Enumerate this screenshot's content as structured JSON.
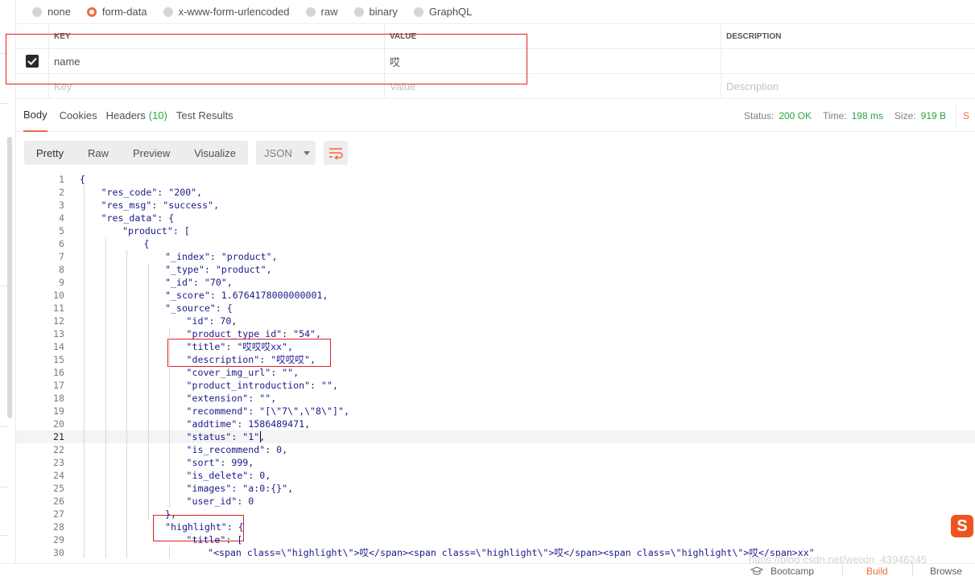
{
  "body_types": [
    {
      "label": "none",
      "selected": false
    },
    {
      "label": "form-data",
      "selected": true
    },
    {
      "label": "x-www-form-urlencoded",
      "selected": false
    },
    {
      "label": "raw",
      "selected": false
    },
    {
      "label": "binary",
      "selected": false
    },
    {
      "label": "GraphQL",
      "selected": false
    }
  ],
  "params": {
    "headers": {
      "key": "KEY",
      "value": "VALUE",
      "description": "DESCRIPTION"
    },
    "row": {
      "key": "name",
      "value": "哎",
      "description": "",
      "checked": true
    },
    "placeholders": {
      "key": "Key",
      "value": "Value",
      "description": "Description"
    }
  },
  "response_tabs": {
    "body": "Body",
    "cookies": "Cookies",
    "headers": "Headers",
    "headers_count": "(10)",
    "test_results": "Test Results"
  },
  "status": {
    "status_label": "Status:",
    "status_value": "200 OK",
    "time_label": "Time:",
    "time_value": "198 ms",
    "size_label": "Size:",
    "size_value": "919 B",
    "save_label": "S"
  },
  "view": {
    "pretty": "Pretty",
    "raw": "Raw",
    "preview": "Preview",
    "visualize": "Visualize",
    "format": "JSON"
  },
  "code_lines": [
    {
      "n": "1",
      "indent": 0,
      "text": "{"
    },
    {
      "n": "2",
      "indent": 1,
      "text": "\"res_code\": \"200\","
    },
    {
      "n": "3",
      "indent": 1,
      "text": "\"res_msg\": \"success\","
    },
    {
      "n": "4",
      "indent": 1,
      "text": "\"res_data\": {"
    },
    {
      "n": "5",
      "indent": 2,
      "text": "\"product\": ["
    },
    {
      "n": "6",
      "indent": 3,
      "text": "{"
    },
    {
      "n": "7",
      "indent": 4,
      "text": "\"_index\": \"product\","
    },
    {
      "n": "8",
      "indent": 4,
      "text": "\"_type\": \"product\","
    },
    {
      "n": "9",
      "indent": 4,
      "text": "\"_id\": \"70\","
    },
    {
      "n": "10",
      "indent": 4,
      "text": "\"_score\": 1.6764178000000001,"
    },
    {
      "n": "11",
      "indent": 4,
      "text": "\"_source\": {"
    },
    {
      "n": "12",
      "indent": 5,
      "text": "\"id\": 70,"
    },
    {
      "n": "13",
      "indent": 5,
      "text": "\"product_type_id\": \"54\","
    },
    {
      "n": "14",
      "indent": 5,
      "text": "\"title\": \"哎哎哎xx\","
    },
    {
      "n": "15",
      "indent": 5,
      "text": "\"description\": \"哎哎哎\","
    },
    {
      "n": "16",
      "indent": 5,
      "text": "\"cover_img_url\": \"\","
    },
    {
      "n": "17",
      "indent": 5,
      "text": "\"product_introduction\": \"\","
    },
    {
      "n": "18",
      "indent": 5,
      "text": "\"extension\": \"\","
    },
    {
      "n": "19",
      "indent": 5,
      "text": "\"recommend\": \"[\\\"7\\\",\\\"8\\\"]\","
    },
    {
      "n": "20",
      "indent": 5,
      "text": "\"addtime\": 1586489471,"
    },
    {
      "n": "21",
      "indent": 5,
      "text": "\"status\": \"1\","
    },
    {
      "n": "22",
      "indent": 5,
      "text": "\"is_recommend\": 0,"
    },
    {
      "n": "23",
      "indent": 5,
      "text": "\"sort\": 999,"
    },
    {
      "n": "24",
      "indent": 5,
      "text": "\"is_delete\": 0,"
    },
    {
      "n": "25",
      "indent": 5,
      "text": "\"images\": \"a:0:{}\","
    },
    {
      "n": "26",
      "indent": 5,
      "text": "\"user_id\": 0"
    },
    {
      "n": "27",
      "indent": 4,
      "text": "},"
    },
    {
      "n": "28",
      "indent": 4,
      "text": "\"highlight\": {"
    },
    {
      "n": "29",
      "indent": 5,
      "text": "\"title\": ["
    },
    {
      "n": "30",
      "indent": 6,
      "text": "\"<span class=\\\"highlight\\\">哎</span><span class=\\\"highlight\\\">哎</span><span class=\\\"highlight\\\">哎</span>xx\""
    }
  ],
  "bottom_bar": {
    "bootcamp": "Bootcamp",
    "build": "Build",
    "browse": "Browse"
  },
  "watermark": "https://blog.csdn.net/weixin_43946245",
  "colors": {
    "accent": "#f26b3a",
    "success": "#26a641",
    "annotation_box": "#e02020",
    "code_text": "#1a1a8a"
  }
}
